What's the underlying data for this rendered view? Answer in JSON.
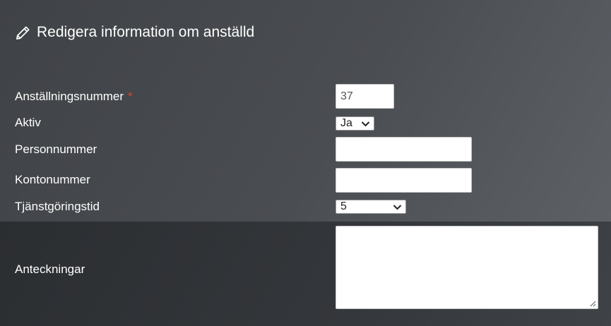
{
  "header": {
    "icon": "pencil-icon",
    "title": "Redigera information om anställd"
  },
  "form": {
    "employee_number": {
      "label": "Anställningsnummer",
      "required_mark": "*",
      "value": "37"
    },
    "active": {
      "label": "Aktiv",
      "selected": "Ja"
    },
    "personal_number": {
      "label": "Personnummer",
      "value": ""
    },
    "account_number": {
      "label": "Kontonummer",
      "value": ""
    },
    "service_time": {
      "label": "Tjänstgöringstid",
      "selected": "5"
    },
    "notes": {
      "label": "Anteckningar",
      "value": ""
    }
  },
  "colors": {
    "required": "#d9472b",
    "background_top": "#4a4d52",
    "background_bottom": "#34373b"
  }
}
